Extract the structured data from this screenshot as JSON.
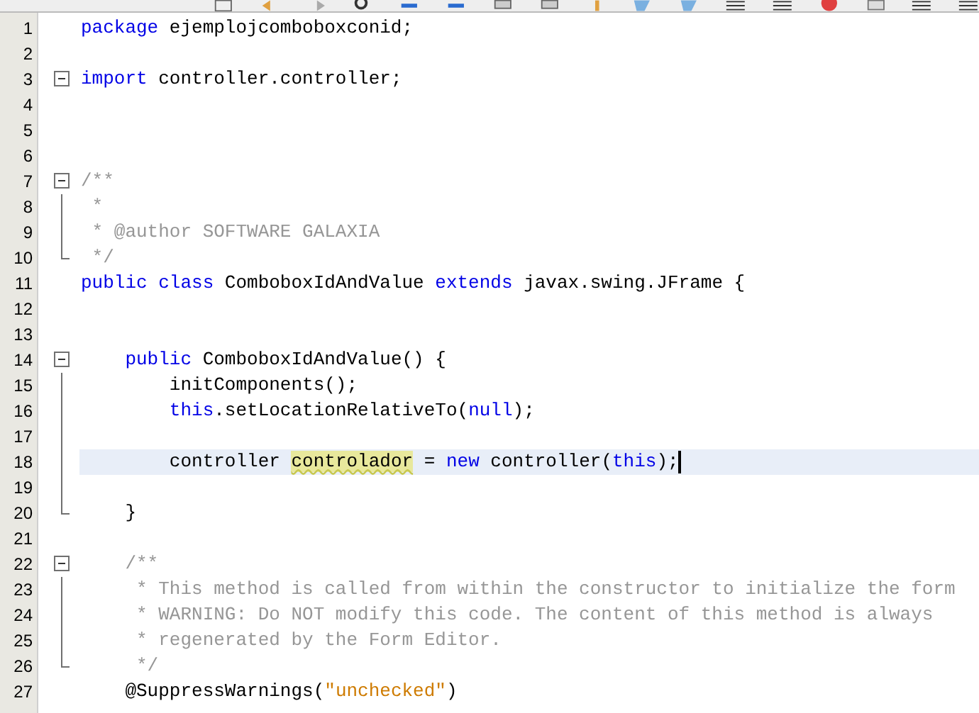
{
  "editor": {
    "lines": [
      {
        "number": "1",
        "tokens": [
          {
            "kind": "keyword",
            "text": "package"
          },
          {
            "kind": "plain",
            "text": " ejemplojcomboboxconid;"
          }
        ]
      },
      {
        "number": "2"
      },
      {
        "number": "3",
        "kind": "foldstart",
        "expanded": true,
        "tokens": [
          {
            "kind": "keyword",
            "text": "import"
          },
          {
            "kind": "plain",
            "text": " controller.controller;"
          }
        ]
      },
      {
        "number": "4"
      },
      {
        "number": "5"
      },
      {
        "number": "6"
      },
      {
        "number": "7",
        "kind": "foldstart",
        "expanded": true,
        "tokens": [
          {
            "kind": "comment",
            "text": "/**"
          }
        ]
      },
      {
        "number": "8",
        "kind": "foldbody",
        "tokens": [
          {
            "kind": "comment",
            "text": " *"
          }
        ]
      },
      {
        "number": "9",
        "kind": "foldbody",
        "tokens": [
          {
            "kind": "comment",
            "text": " * @author SOFTWARE GALAXIA"
          }
        ]
      },
      {
        "number": "10",
        "kind": "foldend",
        "tokens": [
          {
            "kind": "comment",
            "text": " */"
          }
        ]
      },
      {
        "number": "11",
        "tokens": [
          {
            "kind": "keyword",
            "text": "public class"
          },
          {
            "kind": "plain",
            "text": " ComboboxIdAndValue "
          },
          {
            "kind": "keyword",
            "text": "extends"
          },
          {
            "kind": "plain",
            "text": " javax.swing.JFrame {"
          }
        ]
      },
      {
        "number": "12"
      },
      {
        "number": "13"
      },
      {
        "number": "14",
        "kind": "foldstart",
        "expanded": true,
        "tokens": [
          {
            "kind": "keyword",
            "text": "    public"
          },
          {
            "kind": "plain",
            "text": " ComboboxIdAndValue() {"
          }
        ]
      },
      {
        "number": "15",
        "kind": "foldbody",
        "tokens": [
          {
            "kind": "plain",
            "text": "        initComponents();"
          }
        ]
      },
      {
        "number": "16",
        "kind": "foldbody",
        "tokens": [
          {
            "kind": "keyword",
            "text": "        this"
          },
          {
            "kind": "plain",
            "text": ".setLocationRelativeTo("
          },
          {
            "kind": "keyword",
            "text": "null"
          },
          {
            "kind": "plain",
            "text": ");"
          }
        ]
      },
      {
        "number": "17",
        "kind": "foldbody"
      },
      {
        "number": "18",
        "kind": "foldbody",
        "current": true,
        "tokens": [
          {
            "kind": "plain",
            "text": "        controller "
          },
          {
            "kind": "marked",
            "text": "controlador"
          },
          {
            "kind": "plain",
            "text": " = "
          },
          {
            "kind": "keyword",
            "text": "new"
          },
          {
            "kind": "plain",
            "text": " controller("
          },
          {
            "kind": "keyword",
            "text": "this"
          },
          {
            "kind": "plain",
            "text": ");"
          }
        ]
      },
      {
        "number": "19",
        "kind": "foldbody"
      },
      {
        "number": "20",
        "kind": "foldend",
        "tokens": [
          {
            "kind": "plain",
            "text": "    }"
          }
        ]
      },
      {
        "number": "21"
      },
      {
        "number": "22",
        "kind": "foldstart",
        "expanded": true,
        "tokens": [
          {
            "kind": "comment",
            "text": "    /**"
          }
        ]
      },
      {
        "number": "23",
        "kind": "foldbody",
        "tokens": [
          {
            "kind": "comment",
            "text": "     * This method is called from within the constructor to initialize the form"
          }
        ]
      },
      {
        "number": "24",
        "kind": "foldbody",
        "tokens": [
          {
            "kind": "comment",
            "text": "     * WARNING: Do NOT modify this code. The content of this method is always"
          }
        ]
      },
      {
        "number": "25",
        "kind": "foldbody",
        "tokens": [
          {
            "kind": "comment",
            "text": "     * regenerated by the Form Editor."
          }
        ]
      },
      {
        "number": "26",
        "kind": "foldend",
        "tokens": [
          {
            "kind": "comment",
            "text": "     */"
          }
        ]
      },
      {
        "number": "27",
        "tokens": [
          {
            "kind": "annotation",
            "text": "    @SuppressWarnings("
          },
          {
            "kind": "string",
            "text": "\"unchecked\""
          },
          {
            "kind": "annotation",
            "text": ")"
          }
        ]
      }
    ]
  }
}
